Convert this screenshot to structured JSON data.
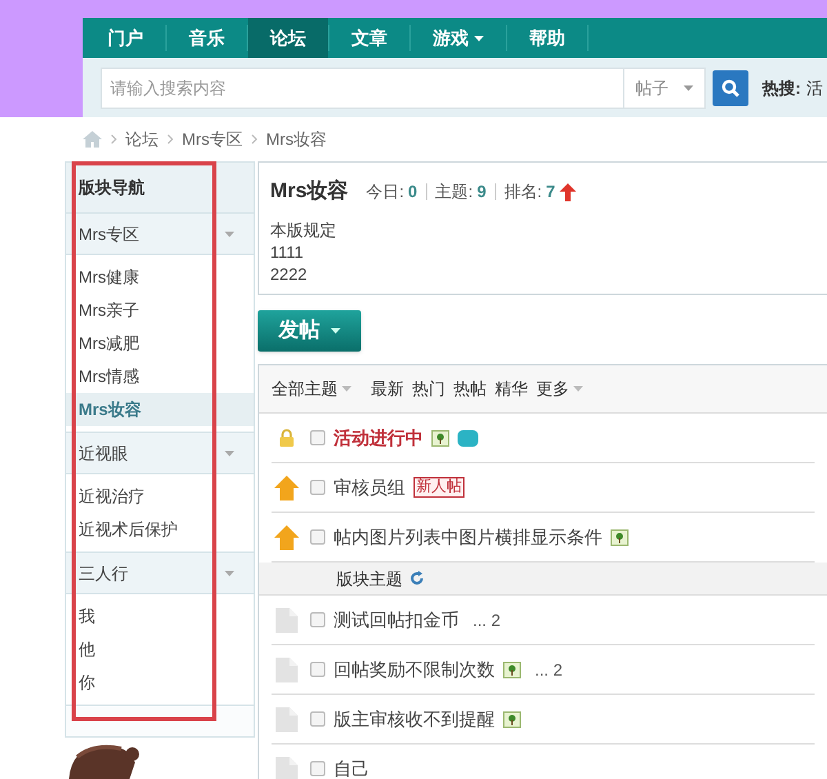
{
  "nav": {
    "items": [
      {
        "label": "门户",
        "selected": false,
        "dropdown": false
      },
      {
        "label": "音乐",
        "selected": false,
        "dropdown": false
      },
      {
        "label": "论坛",
        "selected": true,
        "dropdown": false
      },
      {
        "label": "文章",
        "selected": false,
        "dropdown": false
      },
      {
        "label": "游戏",
        "selected": false,
        "dropdown": true
      },
      {
        "label": "帮助",
        "selected": false,
        "dropdown": false
      }
    ]
  },
  "search": {
    "placeholder": "请输入搜索内容",
    "scope": "帖子",
    "hot_label": "热搜:",
    "hot_keyword": "活"
  },
  "breadcrumb": [
    "论坛",
    "Mrs专区",
    "Mrs妆容"
  ],
  "sidebar": {
    "title": "版块导航",
    "groups": [
      {
        "label": "Mrs专区",
        "items": [
          {
            "label": "Mrs健康",
            "selected": false
          },
          {
            "label": "Mrs亲子",
            "selected": false
          },
          {
            "label": "Mrs减肥",
            "selected": false
          },
          {
            "label": "Mrs情感",
            "selected": false
          },
          {
            "label": "Mrs妆容",
            "selected": true
          }
        ]
      },
      {
        "label": "近视眼",
        "items": [
          {
            "label": "近视治疗",
            "selected": false
          },
          {
            "label": "近视术后保护",
            "selected": false
          }
        ]
      },
      {
        "label": "三人行",
        "items": [
          {
            "label": "我",
            "selected": false
          },
          {
            "label": "他",
            "selected": false
          },
          {
            "label": "你",
            "selected": false
          }
        ]
      }
    ]
  },
  "forum": {
    "name": "Mrs妆容",
    "stats": [
      {
        "label": "今日:",
        "value": "0"
      },
      {
        "label": "主题:",
        "value": "9"
      },
      {
        "label": "排名:",
        "value": "7"
      }
    ],
    "rank_up": true,
    "rules": [
      "本版规定",
      "1111",
      "2222"
    ]
  },
  "post_button": "发帖",
  "filters": [
    {
      "label": "全部主题",
      "dropdown": true
    },
    {
      "label": "最新",
      "dropdown": false
    },
    {
      "label": "热门",
      "dropdown": false
    },
    {
      "label": "热帖",
      "dropdown": false
    },
    {
      "label": "精华",
      "dropdown": false
    },
    {
      "label": "更多",
      "dropdown": true
    }
  ],
  "threads": [
    {
      "kind": "thread",
      "closed": true,
      "sticky": false,
      "title": "活动进行中",
      "highlighted": true,
      "checked": false,
      "image": true,
      "activity": true
    },
    {
      "kind": "thread",
      "closed": false,
      "sticky": true,
      "title": "审核员组",
      "highlighted": false,
      "checked": false,
      "badge": "新人帖"
    },
    {
      "kind": "thread",
      "closed": false,
      "sticky": true,
      "title": "帖内图片列表中图片横排显示条件",
      "highlighted": false,
      "checked": false,
      "image": true
    },
    {
      "kind": "section",
      "title": "版块主题"
    },
    {
      "kind": "thread",
      "closed": false,
      "sticky": false,
      "title": "测试回帖扣金币",
      "highlighted": false,
      "checked": false,
      "pages": "... 2"
    },
    {
      "kind": "thread",
      "closed": false,
      "sticky": false,
      "title": "回帖奖励不限制次数",
      "highlighted": false,
      "checked": false,
      "image": true,
      "pages": "... 2"
    },
    {
      "kind": "thread",
      "closed": false,
      "sticky": false,
      "title": "版主审核收不到提醒",
      "highlighted": false,
      "checked": false,
      "image": true
    },
    {
      "kind": "thread",
      "closed": false,
      "sticky": false,
      "title": "自己",
      "highlighted": false,
      "checked": false
    }
  ]
}
